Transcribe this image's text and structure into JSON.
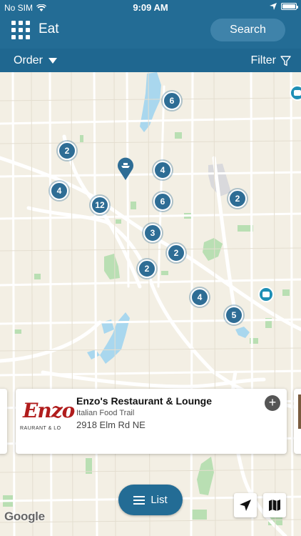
{
  "status_bar": {
    "carrier": "No SIM",
    "time": "9:09 AM"
  },
  "header": {
    "title": "Eat",
    "search_label": "Search"
  },
  "toolbar": {
    "order_label": "Order",
    "filter_label": "Filter"
  },
  "map": {
    "clusters": [
      {
        "count": "6"
      },
      {
        "count": "2"
      },
      {
        "count": "4"
      },
      {
        "count": "4"
      },
      {
        "count": "12"
      },
      {
        "count": "6"
      },
      {
        "count": "2"
      },
      {
        "count": "3"
      },
      {
        "count": "2"
      },
      {
        "count": "2"
      },
      {
        "count": "4"
      },
      {
        "count": "5"
      }
    ],
    "attribution": "Google",
    "colors": {
      "water": "#a9d7ee",
      "park": "#b9dfb3",
      "road": "#ffffff",
      "marker": "#2e6d95"
    }
  },
  "card": {
    "logo_script": "Enzo",
    "logo_small": "RAURANT & LO",
    "title": "Enzo's Restaurant & Lounge",
    "subtitle": "Italian Food Trail",
    "address": "2918 Elm Rd NE"
  },
  "list_button": {
    "label": "List"
  },
  "icons": [
    "grid-menu-icon",
    "chevron-down-icon",
    "filter-icon",
    "location-arrow-icon",
    "map-icon",
    "plus-icon",
    "list-icon",
    "wifi-icon",
    "battery-icon"
  ]
}
